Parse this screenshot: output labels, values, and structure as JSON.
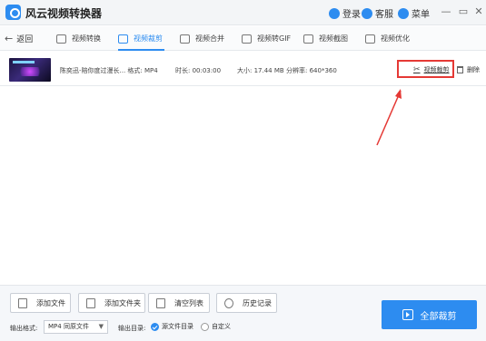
{
  "window": {
    "title": "风云视频转换器",
    "login_label": "登录",
    "service_label": "客服",
    "menu_label": "菜单",
    "minimize_glyph": "—",
    "maximize_glyph": "▭",
    "close_glyph": "✕"
  },
  "nav": {
    "back_label": "返回",
    "tabs": [
      {
        "label": "视频转换"
      },
      {
        "label": "视频裁剪"
      },
      {
        "label": "视频合并"
      },
      {
        "label": "视频转GIF"
      },
      {
        "label": "视频截图"
      },
      {
        "label": "视频优化"
      }
    ],
    "active_tab": "视频裁剪"
  },
  "files": [
    {
      "name": "陈奕迅-陪你度过漫长... 格式: MP4",
      "duration": "时长: 00:03:00",
      "size": "大小: 17.44 MB",
      "resolution": "分辨率: 640*360",
      "action_label": "视频裁剪",
      "delete_label": "删除"
    }
  ],
  "bottom": {
    "add_file_label": "添加文件",
    "add_folder_label": "添加文件夹",
    "clear_list_label": "清空列表",
    "history_label": "历史记录",
    "format_label": "输出格式:",
    "format_value": "MP4 同原文件",
    "output_label": "输出目录:",
    "source_dir_label": "源文件目录",
    "custom_label": "自定义",
    "selected_output": "源文件目录",
    "start_label": "全部裁剪"
  },
  "colors": {
    "accent": "#2d8cf0",
    "highlight_box": "#e53935"
  },
  "icons": {
    "logo": "app-logo",
    "login": "user-icon",
    "service": "headset-icon",
    "menu": "menu-icon",
    "cut": "scissors-icon",
    "delete": "trash-icon",
    "start": "play-icon"
  }
}
